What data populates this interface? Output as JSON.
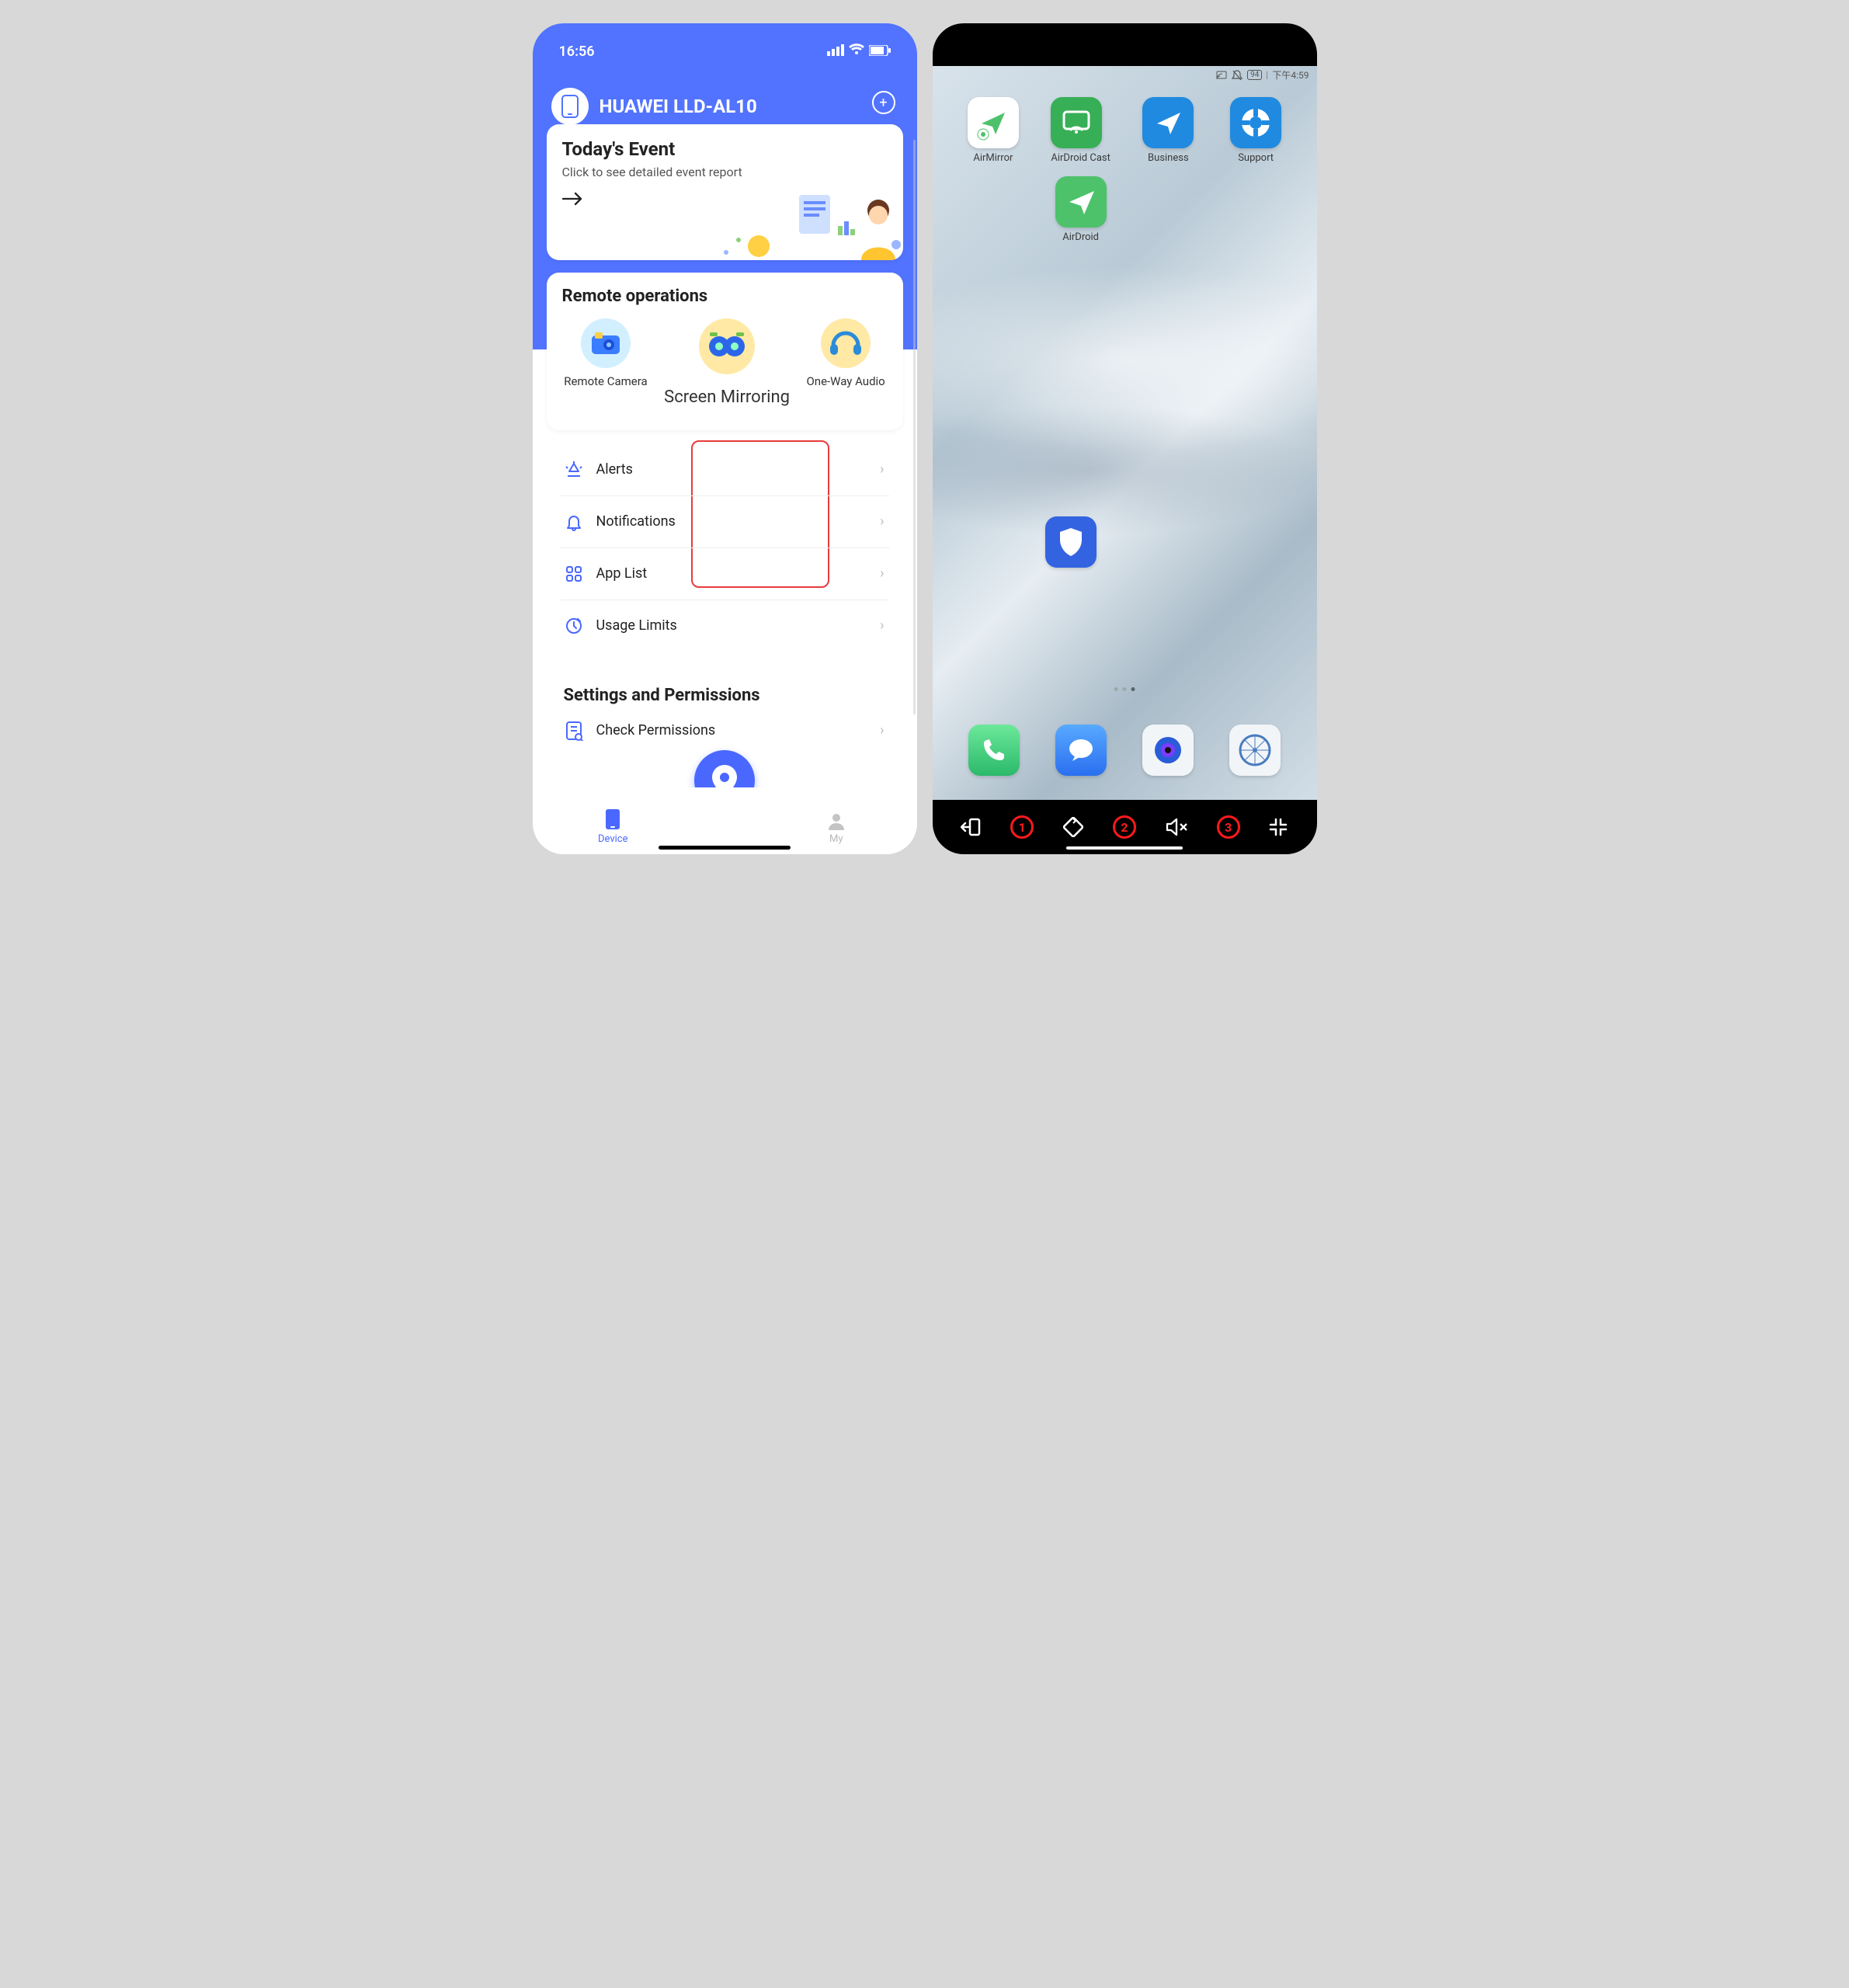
{
  "left": {
    "status_time": "16:56",
    "device_name": "HUAWEI LLD-AL10",
    "event": {
      "title": "Today's Event",
      "subtitle": "Click to see detailed event report"
    },
    "remote": {
      "section_title": "Remote operations",
      "items": [
        {
          "label": "Remote Camera"
        },
        {
          "label": "Screen Mirroring",
          "highlight": true
        },
        {
          "label": "One-Way Audio"
        }
      ]
    },
    "menu": [
      {
        "label": "Alerts",
        "icon": "alerts-icon"
      },
      {
        "label": "Notifications",
        "icon": "bell-icon"
      },
      {
        "label": "App List",
        "icon": "grid-icon"
      },
      {
        "label": "Usage Limits",
        "icon": "clock-icon"
      }
    ],
    "settings": {
      "section_title": "Settings and Permissions",
      "items": [
        {
          "label": "Check Permissions"
        }
      ]
    },
    "tabs": {
      "device": "Device",
      "my": "My"
    }
  },
  "right": {
    "status": {
      "battery": "94",
      "time": "下午4:59"
    },
    "apps_row1": [
      {
        "label": "AirMirror"
      },
      {
        "label": "AirDroid Cast"
      },
      {
        "label": "Business"
      },
      {
        "label": "Support"
      }
    ],
    "apps_row2": [
      {
        "label": "AirDroid"
      }
    ],
    "nav_numbers": [
      "1",
      "2",
      "3"
    ]
  }
}
